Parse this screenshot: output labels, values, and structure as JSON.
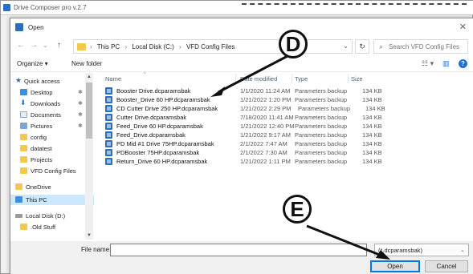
{
  "app": {
    "title": "Drive Composer pro v.2.7"
  },
  "dialog": {
    "title": "Open",
    "close_glyph": "✕"
  },
  "nav": {
    "back": "←",
    "forward": "→",
    "dropdown": "⌄",
    "up": "↑",
    "breadcrumbs": [
      "This PC",
      "Local Disk (C:)",
      "VFD Config Files"
    ],
    "address_dropdown": "⌄",
    "refresh": "↻",
    "search_placeholder": "Search VFD Config Files"
  },
  "toolbar": {
    "organize": "Organize ▾",
    "new_folder": "New folder"
  },
  "sidebar": {
    "items": [
      {
        "label": "Quick access",
        "icon": "star-icon",
        "pinned": false
      },
      {
        "label": "Desktop",
        "icon": "desktop-icon",
        "pinned": true
      },
      {
        "label": "Downloads",
        "icon": "download-icon",
        "pinned": true
      },
      {
        "label": "Documents",
        "icon": "documents-icon",
        "pinned": true
      },
      {
        "label": "Pictures",
        "icon": "pictures-icon",
        "pinned": true
      },
      {
        "label": "config",
        "icon": "folder-icon",
        "pinned": false
      },
      {
        "label": "datatest",
        "icon": "folder-icon",
        "pinned": false
      },
      {
        "label": "Projects",
        "icon": "folder-icon",
        "pinned": false
      },
      {
        "label": "VFD Config Files",
        "icon": "folder-icon",
        "pinned": false
      },
      {
        "label": "OneDrive",
        "icon": "folder-icon",
        "pinned": false
      },
      {
        "label": "This PC",
        "icon": "pc-icon",
        "pinned": false
      },
      {
        "label": "Local Disk (D:)",
        "icon": "drive-icon",
        "pinned": false
      },
      {
        "label": ".Old Stuff",
        "icon": "folder-icon",
        "pinned": false
      }
    ],
    "selected": "This PC"
  },
  "columns": {
    "name": "Name",
    "date": "Date modified",
    "type": "Type",
    "size": "Size"
  },
  "files": [
    {
      "name": "Booster Drive.dcparamsbak",
      "date": "1/1/2020 11:24 AM",
      "type": "Parameters backup",
      "size": "134 KB"
    },
    {
      "name": "Booster_Drive 60 HP.dcparamsbak",
      "date": "1/21/2022 1:20 PM",
      "type": "Parameters backup",
      "size": "134 KB"
    },
    {
      "name": "CD Cutter Drive 250 HP.dcparamsbak",
      "date": "1/21/2022 2:29 PM",
      "type": "Parameters backup",
      "size": "134 KB"
    },
    {
      "name": "Cutter Drive.dcparamsbak",
      "date": "7/18/2020 11:41 AM",
      "type": "Parameters backup",
      "size": "134 KB"
    },
    {
      "name": "Feed_Drive 60 HP.dcparamsbak",
      "date": "1/21/2022 12:40 PM",
      "type": "Parameters backup",
      "size": "134 KB"
    },
    {
      "name": "Feed_Drive.dcparamsbak",
      "date": "1/21/2022 9:17 AM",
      "type": "Parameters backup",
      "size": "134 KB"
    },
    {
      "name": "PD Mid #1 Drive 75HP.dcparamsbak",
      "date": "2/1/2022 7:47 AM",
      "type": "Parameters backup",
      "size": "134 KB"
    },
    {
      "name": "PDBooster 75HP.dcparamsbak",
      "date": "2/1/2022 7:30 AM",
      "type": "Parameters backup",
      "size": "134 KB"
    },
    {
      "name": "Return_Drive 60 HP.dcparamsbak",
      "date": "1/21/2022 1:11 PM",
      "type": "Parameters backup",
      "size": "134 KB"
    }
  ],
  "bottom": {
    "file_name_label": "File name:",
    "file_name_value": "",
    "filter_value": "(*.dcparamsbak)",
    "open_label": "Open",
    "cancel_label": "Cancel"
  },
  "callouts": {
    "d": "D",
    "e": "E"
  },
  "colors": {
    "accent": "#0078d7",
    "selection": "#cce8ff",
    "folder": "#f2c94c",
    "app_icon": "#2a6ebd"
  }
}
